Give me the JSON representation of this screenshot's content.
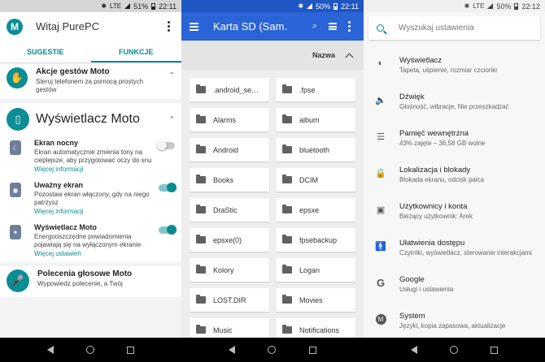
{
  "panel1": {
    "status": {
      "bt": "✱",
      "lte": "LTE",
      "battery": "51%",
      "time": "22:11"
    },
    "logo": "M",
    "title": "Witaj PurePC",
    "tabs": [
      {
        "label": "SUGESTIE"
      },
      {
        "label": "FUNKCJE"
      }
    ],
    "gesture_card": {
      "title": "Akcje gestów Moto",
      "desc": "Steruj telefonem za pomocą prostych gestów"
    },
    "display_section": {
      "title": "Wyświetlacz Moto"
    },
    "features": [
      {
        "title": "Ekran nocny",
        "desc": "Ekran automatycznie zmienia tony na cieplejsze, aby przygotować oczy do snu",
        "link": "Więcej informacji",
        "toggle": "off"
      },
      {
        "title": "Uważny ekran",
        "desc": "Pozostaw ekran włączony, gdy na niego patrzysz",
        "link": "Więcej informacji",
        "toggle": "on"
      },
      {
        "title": "Wyświetlacz Moto",
        "desc": "Energooszczędne powiadomienia pojawiają się na wyłączonym ekranie",
        "link": "Więcej ustawień",
        "toggle": "on"
      }
    ],
    "voice_card": {
      "title": "Polecenia głosowe Moto",
      "desc": "Wypowiedz polecenie, a Twój"
    }
  },
  "panel2": {
    "status": {
      "bt": "✱",
      "battery": "50%",
      "time": "22:11"
    },
    "title": "Karta SD (Sam…",
    "sort_label": "Nazwa",
    "folders": [
      ".android_se…",
      ".fpse",
      "Alarms",
      "album",
      "Android",
      "bluetooth",
      "Books",
      "DCIM",
      "DraStic",
      "epsxe",
      "epsxe(0)",
      "fpsebackup",
      "Kolory",
      "Logan",
      "LOST.DIR",
      "Movies",
      "Music",
      "Notifications"
    ]
  },
  "panel3": {
    "status": {
      "bt": "✱",
      "lte": "LTE",
      "battery": "50%",
      "time": "22:12"
    },
    "search_placeholder": "Wyszukaj ustawienia",
    "items": [
      {
        "title": "Wyświetlacz",
        "sub": "Tapeta, uśpienie, rozmiar czcionki",
        "icon": "brightness-icon"
      },
      {
        "title": "Dźwięk",
        "sub": "Głośność, wibracje, Nie przeszkadzać",
        "icon": "volume-icon"
      },
      {
        "title": "Pamięć wewnętrzna",
        "sub": "43% zajęte – 36,58 GB wolne",
        "icon": "storage-icon"
      },
      {
        "title": "Lokalizacja i blokady",
        "sub": "Blokada ekranu, odcisk palca",
        "icon": "lock-icon"
      },
      {
        "title": "Użytkownicy i konta",
        "sub": "Bieżący użytkownik: Arek",
        "icon": "account-icon"
      },
      {
        "title": "Ułatwienia dostępu",
        "sub": "Czytniki, wyświetlacz, sterowanie interakcjami",
        "icon": "accessibility-icon"
      },
      {
        "title": "Google",
        "sub": "Usługi i ustawienia",
        "icon": "google-icon"
      },
      {
        "title": "System",
        "sub": "Języki, kopia zapasowa, aktualizacje",
        "icon": "motorola-icon"
      }
    ]
  },
  "colors": {
    "teal": "#0b8a93",
    "blue": "#2a64d6"
  }
}
